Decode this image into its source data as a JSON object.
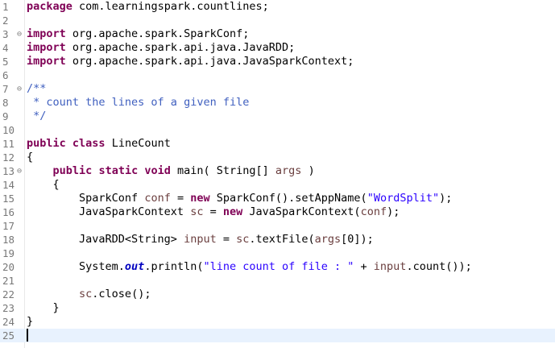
{
  "editor": {
    "lines": [
      {
        "num": "1",
        "fold": "",
        "tokens": [
          {
            "t": "package",
            "c": "kw"
          },
          {
            "t": " com.learningspark.countlines;",
            "c": ""
          }
        ]
      },
      {
        "num": "2",
        "fold": "",
        "tokens": []
      },
      {
        "num": "3",
        "fold": "⊖",
        "tokens": [
          {
            "t": "import",
            "c": "kw"
          },
          {
            "t": " org.apache.spark.SparkConf;",
            "c": ""
          }
        ]
      },
      {
        "num": "4",
        "fold": "",
        "tokens": [
          {
            "t": "import",
            "c": "kw"
          },
          {
            "t": " org.apache.spark.api.java.JavaRDD;",
            "c": ""
          }
        ]
      },
      {
        "num": "5",
        "fold": "",
        "tokens": [
          {
            "t": "import",
            "c": "kw"
          },
          {
            "t": " org.apache.spark.api.java.JavaSparkContext;",
            "c": ""
          }
        ]
      },
      {
        "num": "6",
        "fold": "",
        "tokens": []
      },
      {
        "num": "7",
        "fold": "⊖",
        "tokens": [
          {
            "t": "/**",
            "c": "cmt"
          }
        ]
      },
      {
        "num": "8",
        "fold": "",
        "tokens": [
          {
            "t": " * count the lines of a given file",
            "c": "cmt"
          }
        ]
      },
      {
        "num": "9",
        "fold": "",
        "tokens": [
          {
            "t": " */",
            "c": "cmt"
          }
        ]
      },
      {
        "num": "10",
        "fold": "",
        "tokens": []
      },
      {
        "num": "11",
        "fold": "",
        "tokens": [
          {
            "t": "public",
            "c": "kw"
          },
          {
            "t": " ",
            "c": ""
          },
          {
            "t": "class",
            "c": "kw"
          },
          {
            "t": " LineCount",
            "c": ""
          }
        ]
      },
      {
        "num": "12",
        "fold": "",
        "tokens": [
          {
            "t": "{",
            "c": ""
          }
        ]
      },
      {
        "num": "13",
        "fold": "⊖",
        "tokens": [
          {
            "t": "    ",
            "c": ""
          },
          {
            "t": "public",
            "c": "kw"
          },
          {
            "t": " ",
            "c": ""
          },
          {
            "t": "static",
            "c": "kw"
          },
          {
            "t": " ",
            "c": ""
          },
          {
            "t": "void",
            "c": "kw"
          },
          {
            "t": " main( String[] ",
            "c": ""
          },
          {
            "t": "args",
            "c": "var"
          },
          {
            "t": " )",
            "c": ""
          }
        ]
      },
      {
        "num": "14",
        "fold": "",
        "tokens": [
          {
            "t": "    {",
            "c": ""
          }
        ]
      },
      {
        "num": "15",
        "fold": "",
        "tokens": [
          {
            "t": "        SparkConf ",
            "c": ""
          },
          {
            "t": "conf",
            "c": "var"
          },
          {
            "t": " = ",
            "c": ""
          },
          {
            "t": "new",
            "c": "kw"
          },
          {
            "t": " SparkConf().setAppName(",
            "c": ""
          },
          {
            "t": "\"WordSplit\"",
            "c": "str"
          },
          {
            "t": ");",
            "c": ""
          }
        ]
      },
      {
        "num": "16",
        "fold": "",
        "tokens": [
          {
            "t": "        JavaSparkContext ",
            "c": ""
          },
          {
            "t": "sc",
            "c": "var"
          },
          {
            "t": " = ",
            "c": ""
          },
          {
            "t": "new",
            "c": "kw"
          },
          {
            "t": " JavaSparkContext(",
            "c": ""
          },
          {
            "t": "conf",
            "c": "var"
          },
          {
            "t": ");",
            "c": ""
          }
        ]
      },
      {
        "num": "17",
        "fold": "",
        "tokens": []
      },
      {
        "num": "18",
        "fold": "",
        "tokens": [
          {
            "t": "        JavaRDD<String> ",
            "c": ""
          },
          {
            "t": "input",
            "c": "var"
          },
          {
            "t": " = ",
            "c": ""
          },
          {
            "t": "sc",
            "c": "var"
          },
          {
            "t": ".textFile(",
            "c": ""
          },
          {
            "t": "args",
            "c": "var"
          },
          {
            "t": "[0]);",
            "c": ""
          }
        ]
      },
      {
        "num": "19",
        "fold": "",
        "tokens": []
      },
      {
        "num": "20",
        "fold": "",
        "tokens": [
          {
            "t": "        System.",
            "c": ""
          },
          {
            "t": "out",
            "c": "stat"
          },
          {
            "t": ".println(",
            "c": ""
          },
          {
            "t": "\"line count of file : \"",
            "c": "str"
          },
          {
            "t": " + ",
            "c": ""
          },
          {
            "t": "input",
            "c": "var"
          },
          {
            "t": ".count());",
            "c": ""
          }
        ]
      },
      {
        "num": "21",
        "fold": "",
        "tokens": []
      },
      {
        "num": "22",
        "fold": "",
        "tokens": [
          {
            "t": "        ",
            "c": ""
          },
          {
            "t": "sc",
            "c": "var"
          },
          {
            "t": ".close();",
            "c": ""
          }
        ]
      },
      {
        "num": "23",
        "fold": "",
        "tokens": [
          {
            "t": "    }",
            "c": ""
          }
        ]
      },
      {
        "num": "24",
        "fold": "",
        "tokens": [
          {
            "t": "}",
            "c": ""
          }
        ]
      },
      {
        "num": "25",
        "fold": "",
        "tokens": [],
        "caret": true
      }
    ]
  }
}
